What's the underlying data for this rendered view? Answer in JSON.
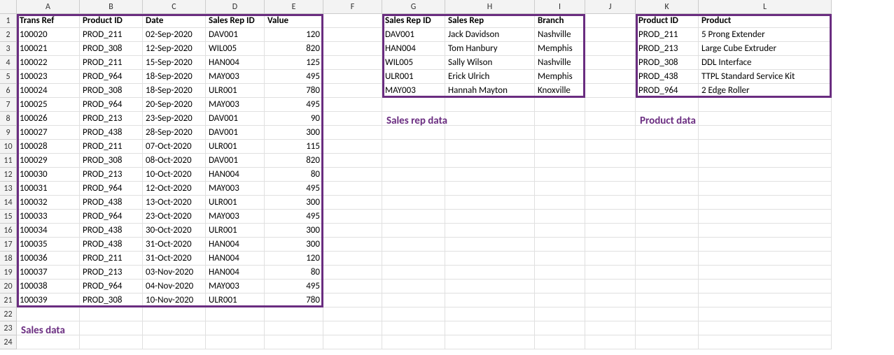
{
  "columns": [
    "",
    "A",
    "B",
    "C",
    "D",
    "E",
    "F",
    "G",
    "H",
    "I",
    "J",
    "K",
    "L"
  ],
  "sales": {
    "headers": [
      "Trans Ref",
      "Product ID",
      "Date",
      "Sales Rep ID",
      "Value"
    ],
    "rows": [
      [
        "100020",
        "PROD_211",
        "02-Sep-2020",
        "DAV001",
        "120"
      ],
      [
        "100021",
        "PROD_308",
        "12-Sep-2020",
        "WIL005",
        "820"
      ],
      [
        "100022",
        "PROD_211",
        "15-Sep-2020",
        "HAN004",
        "125"
      ],
      [
        "100023",
        "PROD_964",
        "18-Sep-2020",
        "MAY003",
        "495"
      ],
      [
        "100024",
        "PROD_308",
        "18-Sep-2020",
        "ULR001",
        "780"
      ],
      [
        "100025",
        "PROD_964",
        "20-Sep-2020",
        "MAY003",
        "495"
      ],
      [
        "100026",
        "PROD_213",
        "23-Sep-2020",
        "DAV001",
        "90"
      ],
      [
        "100027",
        "PROD_438",
        "28-Sep-2020",
        "DAV001",
        "300"
      ],
      [
        "100028",
        "PROD_211",
        "07-Oct-2020",
        "ULR001",
        "115"
      ],
      [
        "100029",
        "PROD_308",
        "08-Oct-2020",
        "DAV001",
        "820"
      ],
      [
        "100030",
        "PROD_213",
        "10-Oct-2020",
        "HAN004",
        "80"
      ],
      [
        "100031",
        "PROD_964",
        "12-Oct-2020",
        "MAY003",
        "495"
      ],
      [
        "100032",
        "PROD_438",
        "13-Oct-2020",
        "ULR001",
        "300"
      ],
      [
        "100033",
        "PROD_964",
        "23-Oct-2020",
        "MAY003",
        "495"
      ],
      [
        "100034",
        "PROD_438",
        "30-Oct-2020",
        "ULR001",
        "300"
      ],
      [
        "100035",
        "PROD_438",
        "31-Oct-2020",
        "HAN004",
        "300"
      ],
      [
        "100036",
        "PROD_211",
        "31-Oct-2020",
        "HAN004",
        "120"
      ],
      [
        "100037",
        "PROD_213",
        "03-Nov-2020",
        "HAN004",
        "80"
      ],
      [
        "100038",
        "PROD_964",
        "04-Nov-2020",
        "MAY003",
        "495"
      ],
      [
        "100039",
        "PROD_308",
        "10-Nov-2020",
        "ULR001",
        "780"
      ]
    ],
    "label": "Sales data"
  },
  "reps": {
    "headers": [
      "Sales Rep ID",
      "Sales Rep",
      "Branch"
    ],
    "rows": [
      [
        "DAV001",
        "Jack Davidson",
        "Nashville"
      ],
      [
        "HAN004",
        "Tom Hanbury",
        "Memphis"
      ],
      [
        "WIL005",
        "Sally Wilson",
        "Nashville"
      ],
      [
        "ULR001",
        "Erick Ulrich",
        "Memphis"
      ],
      [
        "MAY003",
        "Hannah Mayton",
        "Knoxville"
      ]
    ],
    "label": "Sales rep data"
  },
  "products": {
    "headers": [
      "Product ID",
      "Product"
    ],
    "rows": [
      [
        "PROD_211",
        "5 Prong Extender"
      ],
      [
        "PROD_213",
        "Large Cube Extruder"
      ],
      [
        "PROD_308",
        "DDL Interface"
      ],
      [
        "PROD_438",
        "TTPL Standard Service Kit"
      ],
      [
        "PROD_964",
        "2 Edge Roller"
      ]
    ],
    "label": "Product data"
  },
  "row_count": 24,
  "chart_data": {
    "type": "table",
    "tables": [
      {
        "name": "Sales data",
        "columns": [
          "Trans Ref",
          "Product ID",
          "Date",
          "Sales Rep ID",
          "Value"
        ],
        "rows": [
          [
            "100020",
            "PROD_211",
            "02-Sep-2020",
            "DAV001",
            120
          ],
          [
            "100021",
            "PROD_308",
            "12-Sep-2020",
            "WIL005",
            820
          ],
          [
            "100022",
            "PROD_211",
            "15-Sep-2020",
            "HAN004",
            125
          ],
          [
            "100023",
            "PROD_964",
            "18-Sep-2020",
            "MAY003",
            495
          ],
          [
            "100024",
            "PROD_308",
            "18-Sep-2020",
            "ULR001",
            780
          ],
          [
            "100025",
            "PROD_964",
            "20-Sep-2020",
            "MAY003",
            495
          ],
          [
            "100026",
            "PROD_213",
            "23-Sep-2020",
            "DAV001",
            90
          ],
          [
            "100027",
            "PROD_438",
            "28-Sep-2020",
            "DAV001",
            300
          ],
          [
            "100028",
            "PROD_211",
            "07-Oct-2020",
            "ULR001",
            115
          ],
          [
            "100029",
            "PROD_308",
            "08-Oct-2020",
            "DAV001",
            820
          ],
          [
            "100030",
            "PROD_213",
            "10-Oct-2020",
            "HAN004",
            80
          ],
          [
            "100031",
            "PROD_964",
            "12-Oct-2020",
            "MAY003",
            495
          ],
          [
            "100032",
            "PROD_438",
            "13-Oct-2020",
            "ULR001",
            300
          ],
          [
            "100033",
            "PROD_964",
            "23-Oct-2020",
            "MAY003",
            495
          ],
          [
            "100034",
            "PROD_438",
            "30-Oct-2020",
            "ULR001",
            300
          ],
          [
            "100035",
            "PROD_438",
            "31-Oct-2020",
            "HAN004",
            300
          ],
          [
            "100036",
            "PROD_211",
            "31-Oct-2020",
            "HAN004",
            120
          ],
          [
            "100037",
            "PROD_213",
            "03-Nov-2020",
            "HAN004",
            80
          ],
          [
            "100038",
            "PROD_964",
            "04-Nov-2020",
            "MAY003",
            495
          ],
          [
            "100039",
            "PROD_308",
            "10-Nov-2020",
            "ULR001",
            780
          ]
        ]
      },
      {
        "name": "Sales rep data",
        "columns": [
          "Sales Rep ID",
          "Sales Rep",
          "Branch"
        ],
        "rows": [
          [
            "DAV001",
            "Jack Davidson",
            "Nashville"
          ],
          [
            "HAN004",
            "Tom Hanbury",
            "Memphis"
          ],
          [
            "WIL005",
            "Sally Wilson",
            "Nashville"
          ],
          [
            "ULR001",
            "Erick Ulrich",
            "Memphis"
          ],
          [
            "MAY003",
            "Hannah Mayton",
            "Knoxville"
          ]
        ]
      },
      {
        "name": "Product data",
        "columns": [
          "Product ID",
          "Product"
        ],
        "rows": [
          [
            "PROD_211",
            "5 Prong Extender"
          ],
          [
            "PROD_213",
            "Large Cube Extruder"
          ],
          [
            "PROD_308",
            "DDL Interface"
          ],
          [
            "PROD_438",
            "TTPL Standard Service Kit"
          ],
          [
            "PROD_964",
            "2 Edge Roller"
          ]
        ]
      }
    ]
  }
}
